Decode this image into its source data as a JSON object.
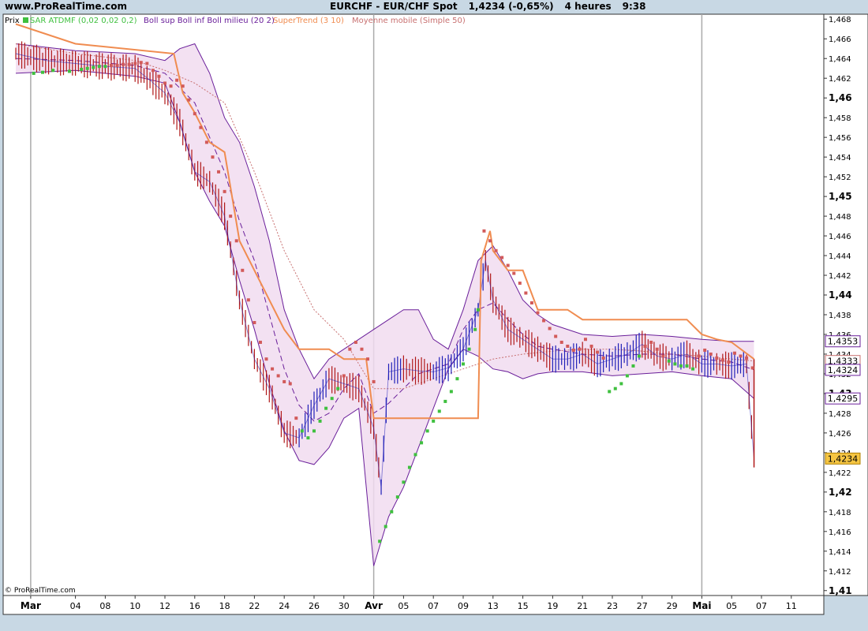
{
  "header": {
    "site": "www.ProRealTime.com",
    "instrument": "EURCHF - EUR/CHF Spot",
    "last": "1,4234 (-0,65%)",
    "interval": "4 heures",
    "time": "9:38"
  },
  "legend": {
    "panel": "Prix",
    "sar": "SAR ATDMF (0,02 0,02 0,2)",
    "boll": "Boll sup Boll inf Boll milieu (20 2)",
    "supertrend": "SuperTrend (3 10)",
    "ma": "Moyenne mobile (Simple 50)"
  },
  "copyright": "© ProRealTime.com",
  "colors": {
    "price": "#1f1fb8",
    "price_down": "#b01818",
    "sar_up": "#3fc03f",
    "sar_down": "#d25a5a",
    "boll": "#6a1f9a",
    "boll_fill": "#f1dcf0",
    "supertrend": "#f08c50",
    "ma": "#c87070",
    "tag_current": "#f5c542"
  },
  "chart_data": {
    "type": "line",
    "title": "EURCHF - EUR/CHF Spot",
    "ylim": [
      1.4095,
      1.4685
    ],
    "xlim": [
      0,
      64
    ],
    "y_ticks": [
      "1,468",
      "1,466",
      "1,464",
      "1,462",
      "1,46",
      "1,458",
      "1,456",
      "1,454",
      "1,452",
      "1,45",
      "1,448",
      "1,446",
      "1,444",
      "1,442",
      "1,44",
      "1,438",
      "1,436",
      "1,434",
      "1,432",
      "1,43",
      "1,428",
      "1,426",
      "1,424",
      "1,422",
      "1,42",
      "1,418",
      "1,416",
      "1,414",
      "1,412",
      "1,41"
    ],
    "y_tick_values": [
      1.468,
      1.466,
      1.464,
      1.462,
      1.46,
      1.458,
      1.456,
      1.454,
      1.452,
      1.45,
      1.448,
      1.446,
      1.444,
      1.442,
      1.44,
      1.438,
      1.436,
      1.434,
      1.432,
      1.43,
      1.428,
      1.426,
      1.424,
      1.422,
      1.42,
      1.418,
      1.416,
      1.414,
      1.412,
      1.41
    ],
    "y_major_ticks": [
      "1,46",
      "1,45",
      "1,44",
      "1,43",
      "1,42",
      "1,41"
    ],
    "x_ticks": [
      {
        "label": "Mar",
        "x": 1,
        "bold": true
      },
      {
        "label": "04",
        "x": 4
      },
      {
        "label": "08",
        "x": 6
      },
      {
        "label": "10",
        "x": 8
      },
      {
        "label": "12",
        "x": 10
      },
      {
        "label": "16",
        "x": 12
      },
      {
        "label": "18",
        "x": 14
      },
      {
        "label": "22",
        "x": 16
      },
      {
        "label": "24",
        "x": 18
      },
      {
        "label": "26",
        "x": 20
      },
      {
        "label": "30",
        "x": 22
      },
      {
        "label": "Avr",
        "x": 24,
        "bold": true
      },
      {
        "label": "05",
        "x": 26
      },
      {
        "label": "07",
        "x": 28
      },
      {
        "label": "09",
        "x": 30
      },
      {
        "label": "13",
        "x": 32
      },
      {
        "label": "15",
        "x": 34
      },
      {
        "label": "19",
        "x": 36
      },
      {
        "label": "21",
        "x": 38
      },
      {
        "label": "23",
        "x": 40
      },
      {
        "label": "27",
        "x": 42
      },
      {
        "label": "29",
        "x": 44
      },
      {
        "label": "Mai",
        "x": 46,
        "bold": true
      },
      {
        "label": "05",
        "x": 48
      },
      {
        "label": "07",
        "x": 50
      },
      {
        "label": "11",
        "x": 52
      }
    ],
    "month_lines_x": [
      1,
      24,
      46
    ],
    "grid": true,
    "price_tags": [
      {
        "label": "1,4353",
        "value": 1.4353,
        "style": "boll"
      },
      {
        "label": "1,4333",
        "value": 1.4333,
        "style": "ma"
      },
      {
        "label": "1,4324",
        "value": 1.4324,
        "style": "boll"
      },
      {
        "label": "1,4295",
        "value": 1.4295,
        "style": "boll"
      },
      {
        "label": "1,4234",
        "value": 1.4234,
        "style": "current"
      }
    ],
    "series": [
      {
        "name": "Prix",
        "type": "line",
        "x": [
          0,
          2,
          4,
          6,
          8,
          9,
          10,
          11,
          12,
          13,
          14,
          15,
          16,
          17,
          18,
          19,
          20,
          21,
          22,
          23,
          24,
          24.5,
          25,
          26,
          27,
          28,
          29,
          30,
          31,
          31.5,
          32,
          33,
          34,
          35,
          36,
          37,
          38,
          39,
          40,
          41,
          42,
          43,
          44,
          45,
          46,
          47,
          48,
          49,
          49.5
        ],
        "values": [
          1.4645,
          1.4638,
          1.4635,
          1.4632,
          1.463,
          1.4618,
          1.4605,
          1.4575,
          1.4525,
          1.4515,
          1.448,
          1.4395,
          1.4335,
          1.4305,
          1.426,
          1.4255,
          1.4288,
          1.4315,
          1.431,
          1.4305,
          1.4265,
          1.4205,
          1.4322,
          1.4325,
          1.4323,
          1.4322,
          1.4326,
          1.4345,
          1.4385,
          1.4435,
          1.4395,
          1.4365,
          1.4355,
          1.4345,
          1.4335,
          1.4335,
          1.434,
          1.433,
          1.4335,
          1.434,
          1.435,
          1.4338,
          1.4335,
          1.434,
          1.433,
          1.433,
          1.4328,
          1.433,
          1.4234
        ]
      },
      {
        "name": "Boll sup",
        "type": "line",
        "x": [
          0,
          4,
          8,
          10,
          11,
          12,
          13,
          14,
          15,
          16,
          17,
          18,
          19,
          20,
          21,
          22,
          23,
          24,
          25,
          26,
          27,
          28,
          29,
          30,
          31,
          32,
          33,
          34,
          35,
          36,
          38,
          40,
          42,
          44,
          46,
          48,
          49.5
        ],
        "values": [
          1.4655,
          1.4648,
          1.4645,
          1.4638,
          1.465,
          1.4655,
          1.4625,
          1.458,
          1.4555,
          1.451,
          1.4455,
          1.4385,
          1.4345,
          1.4315,
          1.4335,
          1.4345,
          1.4355,
          1.4365,
          1.4375,
          1.4385,
          1.4385,
          1.4355,
          1.4345,
          1.4385,
          1.4435,
          1.445,
          1.4425,
          1.4395,
          1.438,
          1.437,
          1.436,
          1.4358,
          1.436,
          1.4358,
          1.4355,
          1.4353,
          1.4353
        ]
      },
      {
        "name": "Boll inf",
        "type": "line",
        "x": [
          0,
          4,
          8,
          10,
          11,
          12,
          13,
          14,
          15,
          16,
          17,
          18,
          19,
          20,
          21,
          22,
          23,
          24,
          25,
          26,
          27,
          28,
          29,
          30,
          31,
          32,
          33,
          34,
          35,
          36,
          38,
          40,
          42,
          44,
          46,
          48,
          49.5
        ],
        "values": [
          1.4625,
          1.4628,
          1.4622,
          1.4615,
          1.4575,
          1.4525,
          1.4495,
          1.447,
          1.4415,
          1.4365,
          1.431,
          1.4262,
          1.4232,
          1.4228,
          1.4245,
          1.4275,
          1.4285,
          1.4125,
          1.4175,
          1.4205,
          1.4245,
          1.4285,
          1.4325,
          1.4345,
          1.4338,
          1.4325,
          1.4322,
          1.4315,
          1.432,
          1.4322,
          1.4322,
          1.4318,
          1.432,
          1.4322,
          1.4318,
          1.4315,
          1.4295
        ]
      },
      {
        "name": "Boll milieu",
        "type": "line",
        "x": [
          0,
          4,
          8,
          10,
          12,
          13,
          14,
          15,
          16,
          17,
          18,
          19,
          20,
          21,
          22,
          23,
          24,
          25,
          26,
          27,
          28,
          29,
          30,
          31,
          32,
          33,
          34,
          35,
          36,
          38,
          40,
          42,
          44,
          46,
          48,
          49.5
        ],
        "values": [
          1.464,
          1.4638,
          1.4633,
          1.4625,
          1.4595,
          1.456,
          1.4525,
          1.4475,
          1.4435,
          1.438,
          1.4325,
          1.4288,
          1.4272,
          1.428,
          1.4305,
          1.432,
          1.428,
          1.429,
          1.4305,
          1.432,
          1.4325,
          1.433,
          1.4365,
          1.4385,
          1.4392,
          1.4375,
          1.436,
          1.4348,
          1.4345,
          1.434,
          1.4338,
          1.434,
          1.434,
          1.4335,
          1.4332,
          1.4324
        ]
      },
      {
        "name": "SuperTrend",
        "type": "line",
        "x": [
          0,
          4,
          10.6,
          11.2,
          12,
          13,
          14,
          15,
          16,
          17,
          18,
          18.5,
          19,
          21,
          22,
          23.5,
          24,
          26,
          31,
          31.2,
          31.8,
          32,
          33,
          34,
          35,
          37,
          38,
          39,
          45,
          46,
          47,
          48,
          49.5
        ],
        "values": [
          1.4675,
          1.4655,
          1.4645,
          1.4605,
          1.4585,
          1.4555,
          1.4545,
          1.4455,
          1.4425,
          1.4395,
          1.4365,
          1.4355,
          1.4345,
          1.4345,
          1.4335,
          1.4335,
          1.4275,
          1.4275,
          1.4275,
          1.4435,
          1.4465,
          1.4445,
          1.4425,
          1.4425,
          1.4385,
          1.4385,
          1.4375,
          1.4375,
          1.4375,
          1.436,
          1.4355,
          1.4352,
          1.4335
        ]
      },
      {
        "name": "Moyenne mobile",
        "type": "line",
        "x": [
          0,
          4,
          8,
          10,
          12,
          14,
          16,
          18,
          20,
          22,
          24,
          26,
          28,
          30,
          32,
          34,
          36,
          38,
          40,
          42,
          44,
          46,
          48,
          49.5
        ],
        "values": [
          1.4655,
          1.4645,
          1.4638,
          1.4628,
          1.4615,
          1.4595,
          1.4525,
          1.4445,
          1.4385,
          1.4355,
          1.4305,
          1.4305,
          1.4315,
          1.4325,
          1.4335,
          1.434,
          1.4343,
          1.4345,
          1.4345,
          1.4343,
          1.434,
          1.4338,
          1.4335,
          1.4333
        ]
      },
      {
        "name": "SAR ATDMF",
        "type": "scatter",
        "points": [
          [
            1.2,
            1.4625
          ],
          [
            1.8,
            1.4626
          ],
          [
            2.5,
            1.4628
          ],
          [
            3.6,
            1.4627
          ],
          [
            4.4,
            1.4629
          ],
          [
            4.8,
            1.463
          ],
          [
            5.2,
            1.4631
          ],
          [
            5.6,
            1.4632
          ],
          [
            6,
            1.4632
          ],
          [
            6.4,
            1.4633
          ],
          [
            6.8,
            1.4633
          ],
          [
            7.2,
            1.4634
          ],
          [
            7.6,
            1.4634
          ],
          [
            8,
            1.4635
          ],
          [
            8.4,
            1.4636
          ],
          [
            8.8,
            1.4635
          ],
          [
            9.2,
            1.4628
          ],
          [
            9.6,
            1.4622
          ],
          [
            10,
            1.4615
          ],
          [
            10.4,
            1.4612
          ],
          [
            10.8,
            1.4618
          ],
          [
            11.2,
            1.4612
          ],
          [
            11.6,
            1.4598
          ],
          [
            12,
            1.4584
          ],
          [
            12.4,
            1.457
          ],
          [
            12.8,
            1.4555
          ],
          [
            13.2,
            1.454
          ],
          [
            13.6,
            1.4525
          ],
          [
            14,
            1.4505
          ],
          [
            14.4,
            1.448
          ],
          [
            14.8,
            1.4455
          ],
          [
            15.2,
            1.4425
          ],
          [
            15.6,
            1.4395
          ],
          [
            16,
            1.4372
          ],
          [
            16.4,
            1.4352
          ],
          [
            16.8,
            1.4335
          ],
          [
            17.2,
            1.4325
          ],
          [
            17.6,
            1.4318
          ],
          [
            18,
            1.4312
          ],
          [
            18.4,
            1.431
          ],
          [
            18.8,
            1.4275
          ],
          [
            19.2,
            1.4262
          ],
          [
            19.6,
            1.4255
          ],
          [
            20,
            1.4262
          ],
          [
            20.4,
            1.4272
          ],
          [
            20.8,
            1.4285
          ],
          [
            21.2,
            1.4295
          ],
          [
            21.6,
            1.4305
          ],
          [
            22,
            1.4318
          ],
          [
            22.4,
            1.4345
          ],
          [
            22.8,
            1.4352
          ],
          [
            23.2,
            1.4345
          ],
          [
            23.6,
            1.4335
          ],
          [
            24,
            1.4312
          ],
          [
            24.4,
            1.415
          ],
          [
            24.8,
            1.4165
          ],
          [
            25.2,
            1.418
          ],
          [
            25.6,
            1.4195
          ],
          [
            26,
            1.421
          ],
          [
            26.4,
            1.4225
          ],
          [
            26.8,
            1.4238
          ],
          [
            27.2,
            1.425
          ],
          [
            27.6,
            1.4262
          ],
          [
            28,
            1.4272
          ],
          [
            28.4,
            1.4282
          ],
          [
            28.8,
            1.4292
          ],
          [
            29.2,
            1.4302
          ],
          [
            29.6,
            1.4315
          ],
          [
            30,
            1.433
          ],
          [
            30.4,
            1.4345
          ],
          [
            30.8,
            1.4365
          ],
          [
            31,
            1.4385
          ],
          [
            31.4,
            1.4465
          ],
          [
            31.8,
            1.4455
          ],
          [
            32.2,
            1.4445
          ],
          [
            32.6,
            1.4438
          ],
          [
            33,
            1.443
          ],
          [
            33.4,
            1.4422
          ],
          [
            33.8,
            1.4412
          ],
          [
            34.2,
            1.4402
          ],
          [
            34.6,
            1.4392
          ],
          [
            35,
            1.4382
          ],
          [
            35.4,
            1.4374
          ],
          [
            35.8,
            1.4366
          ],
          [
            36.2,
            1.4358
          ],
          [
            36.6,
            1.4352
          ],
          [
            37,
            1.4348
          ],
          [
            37.4,
            1.4344
          ],
          [
            37.8,
            1.4345
          ],
          [
            38.2,
            1.4355
          ],
          [
            38.6,
            1.4348
          ],
          [
            39,
            1.4342
          ],
          [
            39.4,
            1.4336
          ],
          [
            39.8,
            1.4302
          ],
          [
            40.2,
            1.4305
          ],
          [
            40.6,
            1.431
          ],
          [
            41,
            1.4318
          ],
          [
            41.4,
            1.4328
          ],
          [
            41.8,
            1.4338
          ],
          [
            42.2,
            1.4348
          ],
          [
            42.6,
            1.4352
          ],
          [
            43,
            1.4345
          ],
          [
            43.4,
            1.4338
          ],
          [
            43.8,
            1.4333
          ],
          [
            44.2,
            1.433
          ],
          [
            44.6,
            1.4328
          ],
          [
            45,
            1.4328
          ],
          [
            45.4,
            1.4325
          ],
          [
            45.8,
            1.4338
          ],
          [
            46.2,
            1.4344
          ],
          [
            46.6,
            1.434
          ],
          [
            47,
            1.4336
          ],
          [
            47.4,
            1.4334
          ],
          [
            47.8,
            1.4332
          ],
          [
            48.2,
            1.4341
          ],
          [
            48.6,
            1.4338
          ],
          [
            49,
            1.4336
          ],
          [
            49.4,
            1.4326
          ]
        ]
      }
    ]
  }
}
